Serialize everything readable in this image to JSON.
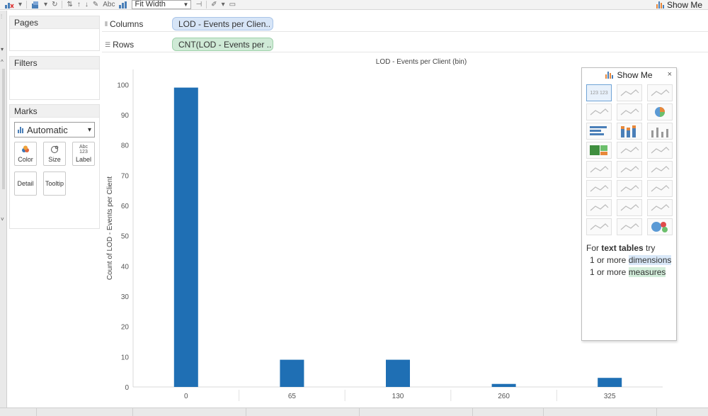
{
  "toolbar": {
    "abc_label": "Abc",
    "fit_select_value": "Fit Width",
    "show_me_label": "Show Me"
  },
  "cards": {
    "pages_title": "Pages",
    "filters_title": "Filters",
    "marks_title": "Marks",
    "mark_type": "Automatic",
    "mark_buttons": [
      {
        "label": "Color",
        "icon": "color-dots-icon"
      },
      {
        "label": "Size",
        "icon": "size-circles-icon"
      },
      {
        "label": "Label",
        "icon": "label-abc-icon",
        "glyph": "Abc\n123"
      },
      {
        "label": "Detail",
        "icon": "detail-icon"
      },
      {
        "label": "Tooltip",
        "icon": "tooltip-icon"
      }
    ]
  },
  "shelves": {
    "columns_label": "Columns",
    "columns_pill": "LOD - Events per Clien..",
    "rows_label": "Rows",
    "rows_pill": "CNT(LOD - Events per .."
  },
  "chart_data": {
    "type": "bar",
    "title": "LOD - Events per Client (bin)",
    "xlabel": "",
    "ylabel": "Count of LOD - Events per Client",
    "categories": [
      "0",
      "65",
      "130",
      "260",
      "325"
    ],
    "values": [
      99,
      9,
      9,
      1,
      3
    ],
    "ylim": [
      0,
      105
    ],
    "yticks": [
      0,
      10,
      20,
      30,
      40,
      50,
      60,
      70,
      80,
      90,
      100
    ],
    "bar_color": "#1f6fb4",
    "grid": false
  },
  "show_me": {
    "title": "Show Me",
    "close": "×",
    "hint_prefix": "For ",
    "hint_bold": "text tables",
    "hint_suffix": " try",
    "req1_prefix": "1 or more ",
    "req1_highlight": "dimensions",
    "req2_prefix": "1 or more ",
    "req2_highlight": "measures",
    "thumb_sample": "123 123"
  },
  "colors": {
    "accent_blue": "#1f6fb4",
    "columns_pill_bg": "#d7e5f7",
    "rows_pill_bg": "#cfead6"
  }
}
